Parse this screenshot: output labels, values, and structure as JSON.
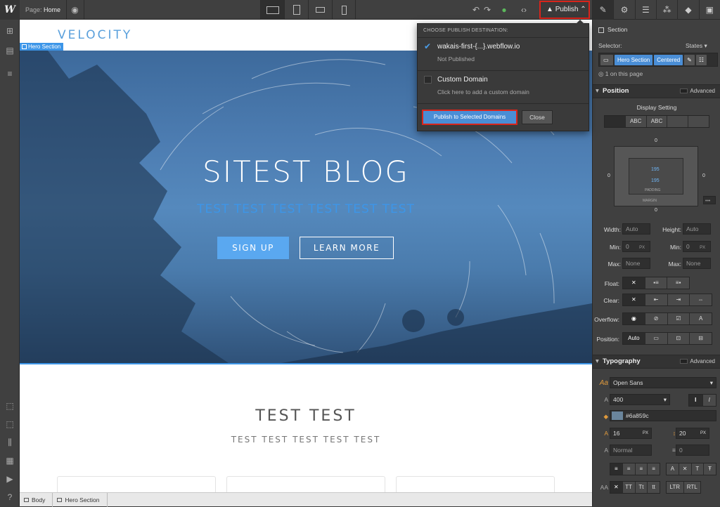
{
  "topbar": {
    "logo": "W",
    "page_label": "Page:",
    "page_name": "Home",
    "publish_label": "Publish ⌃"
  },
  "canvas": {
    "brand": "VELOCITY",
    "hero_badge": "Hero Section",
    "hero_title": "SITEST BLOG",
    "hero_subtitle": "TEST TEST TEST TEST TEST TEST",
    "signup_label": "SIGN UP",
    "learn_more_label": "LEARN MORE",
    "section_title": "TEST TEST",
    "section_subtitle": "TEST TEST TEST TEST TEST"
  },
  "breadcrumbs": [
    "Body",
    "Hero Section"
  ],
  "publish_dropdown": {
    "heading": "CHOOSE PUBLISH DESTINATION:",
    "opt1_title": "wakais-first-{...}.webflow.io",
    "opt1_sub": "Not Published",
    "opt2_title": "Custom Domain",
    "opt2_sub": "Click here to add a custom domain",
    "publish_btn": "Publish to Selected Domains",
    "close_btn": "Close"
  },
  "style_panel": {
    "element_name": "Section",
    "selector_label": "Selector:",
    "states_label": "States ▾",
    "class1": "Hero Section",
    "class2": "Centered",
    "on_page": "1 on this page",
    "position_heading": "Position",
    "advanced": "Advanced",
    "display_setting": "Display Setting",
    "display_opts": [
      "",
      "ABC",
      "ABC",
      "",
      ""
    ],
    "margin_top": "0",
    "margin_bottom": "0",
    "margin_left": "0",
    "margin_right": "0",
    "padding_top": "195",
    "padding_bottom": "195",
    "padding_label": "PADDING",
    "margin_label": "MARGIN",
    "width_label": "Width:",
    "width_value": "Auto",
    "height_label": "Height:",
    "height_value": "Auto",
    "min_label": "Min:",
    "min_w": "0",
    "min_h": "0",
    "unit_px": "PX",
    "max_label": "Max:",
    "max_w": "None",
    "max_h": "None",
    "float_label": "Float:",
    "clear_label": "Clear:",
    "overflow_label": "Overflow:",
    "position_label": "Position:",
    "position_value": "Auto",
    "typography_heading": "Typography",
    "font_family": "Open Sans",
    "font_weight": "400",
    "color_value": "#6a859c",
    "font_size": "16",
    "line_height": "20",
    "letter_spacing": "Normal",
    "text_indent": "0",
    "text_transform": [
      "TT",
      "Tt",
      "tt"
    ]
  }
}
